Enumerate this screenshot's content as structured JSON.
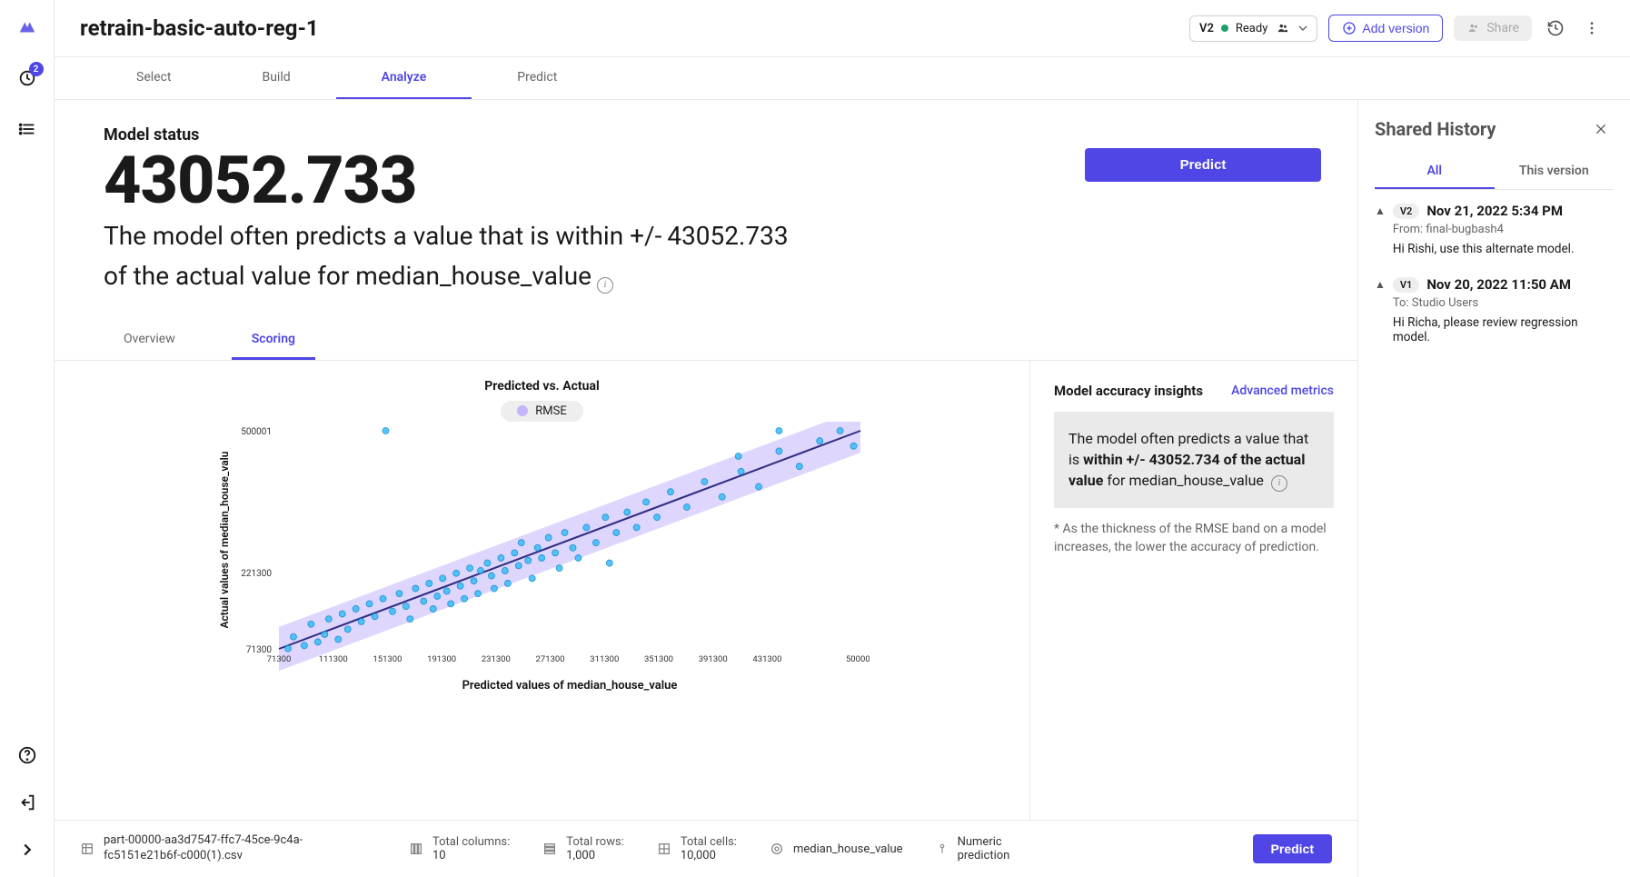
{
  "header": {
    "title": "retrain-basic-auto-reg-1",
    "version_chip": {
      "version": "V2",
      "status": "Ready"
    },
    "add_version": "Add version",
    "share": "Share"
  },
  "rail": {
    "badge_count": "2"
  },
  "tabs": [
    "Select",
    "Build",
    "Analyze",
    "Predict"
  ],
  "active_tab": 2,
  "model_status": {
    "label": "Model status",
    "value": "43052.733",
    "description_prefix": "The model often predicts a value that is within +/- ",
    "description_value": "43052.733",
    "description_suffix": " of the actual value for median_house_value",
    "predict_button": "Predict"
  },
  "subtabs": [
    "Overview",
    "Scoring"
  ],
  "active_subtab": 1,
  "chart_data": {
    "type": "scatter",
    "title": "Predicted vs. Actual",
    "legend": "RMSE",
    "xlabel": "Predicted values of median_house_value",
    "ylabel": "Actual values of median_house_valu",
    "xlim": [
      71300,
      500001
    ],
    "ylim": [
      71300,
      500001
    ],
    "x_ticks": [
      71300,
      111300,
      151300,
      191300,
      231300,
      271300,
      311300,
      351300,
      391300,
      431300,
      500001
    ],
    "y_ticks": [
      71300,
      221300,
      500001
    ],
    "rmse_band": 43052.734,
    "line": {
      "x": [
        71300,
        500001
      ],
      "y": [
        71300,
        500001
      ]
    },
    "points": [
      [
        78000,
        72000
      ],
      [
        82000,
        95000
      ],
      [
        90000,
        78000
      ],
      [
        95000,
        120000
      ],
      [
        100000,
        85000
      ],
      [
        105000,
        100000
      ],
      [
        108000,
        130000
      ],
      [
        115000,
        90000
      ],
      [
        118000,
        140000
      ],
      [
        122000,
        110000
      ],
      [
        128000,
        150000
      ],
      [
        132000,
        125000
      ],
      [
        138000,
        160000
      ],
      [
        142000,
        135000
      ],
      [
        148000,
        170000
      ],
      [
        150000,
        500000
      ],
      [
        155000,
        145000
      ],
      [
        160000,
        180000
      ],
      [
        165000,
        155000
      ],
      [
        168000,
        130000
      ],
      [
        172000,
        190000
      ],
      [
        178000,
        165000
      ],
      [
        182000,
        200000
      ],
      [
        185000,
        150000
      ],
      [
        188000,
        175000
      ],
      [
        192000,
        210000
      ],
      [
        195000,
        185000
      ],
      [
        198000,
        160000
      ],
      [
        202000,
        220000
      ],
      [
        205000,
        195000
      ],
      [
        208000,
        170000
      ],
      [
        212000,
        230000
      ],
      [
        215000,
        205000
      ],
      [
        218000,
        180000
      ],
      [
        220000,
        225000
      ],
      [
        225000,
        240000
      ],
      [
        228000,
        215000
      ],
      [
        230000,
        190000
      ],
      [
        235000,
        250000
      ],
      [
        238000,
        225000
      ],
      [
        240000,
        200000
      ],
      [
        245000,
        260000
      ],
      [
        248000,
        235000
      ],
      [
        250000,
        280000
      ],
      [
        255000,
        245000
      ],
      [
        258000,
        210000
      ],
      [
        262000,
        270000
      ],
      [
        265000,
        250000
      ],
      [
        270000,
        290000
      ],
      [
        275000,
        260000
      ],
      [
        278000,
        230000
      ],
      [
        282000,
        300000
      ],
      [
        288000,
        270000
      ],
      [
        292000,
        250000
      ],
      [
        298000,
        310000
      ],
      [
        305000,
        280000
      ],
      [
        312000,
        330000
      ],
      [
        315000,
        240000
      ],
      [
        320000,
        300000
      ],
      [
        328000,
        340000
      ],
      [
        335000,
        310000
      ],
      [
        342000,
        360000
      ],
      [
        350000,
        330000
      ],
      [
        360000,
        380000
      ],
      [
        372000,
        350000
      ],
      [
        385000,
        400000
      ],
      [
        398000,
        370000
      ],
      [
        410000,
        450000
      ],
      [
        412000,
        420000
      ],
      [
        425000,
        390000
      ],
      [
        440000,
        460000
      ],
      [
        440000,
        500000
      ],
      [
        455000,
        430000
      ],
      [
        470000,
        480000
      ],
      [
        485000,
        500000
      ],
      [
        495000,
        470000
      ]
    ]
  },
  "insights": {
    "title": "Model accuracy insights",
    "advanced": "Advanced metrics",
    "box_prefix": "The model often predicts a value that is ",
    "box_bold": "within +/- 43052.734 of the actual value",
    "box_suffix": " for median_house_value",
    "footnote": "* As the thickness of the RMSE band on a model increases, the lower the accuracy of prediction."
  },
  "footer": {
    "file": "part-00000-aa3d7547-ffc7-45ce-9c4a-fc5151e21b6f-c000(1).csv",
    "cols_label": "Total columns:",
    "cols_value": "10",
    "rows_label": "Total rows:",
    "rows_value": "1,000",
    "cells_label": "Total cells:",
    "cells_value": "10,000",
    "target": "median_house_value",
    "prediction_type": "Numeric prediction",
    "predict_button": "Predict"
  },
  "history": {
    "title": "Shared History",
    "tabs": [
      "All",
      "This version"
    ],
    "active_tab": 0,
    "items": [
      {
        "version": "V2",
        "date": "Nov 21, 2022 5:34 PM",
        "meta": "From: final-bugbash4",
        "msg": "Hi Rishi, use this alternate model."
      },
      {
        "version": "V1",
        "date": "Nov 20, 2022 11:50 AM",
        "meta": "To: Studio Users",
        "msg": "Hi Richa, please review regression model."
      }
    ]
  }
}
